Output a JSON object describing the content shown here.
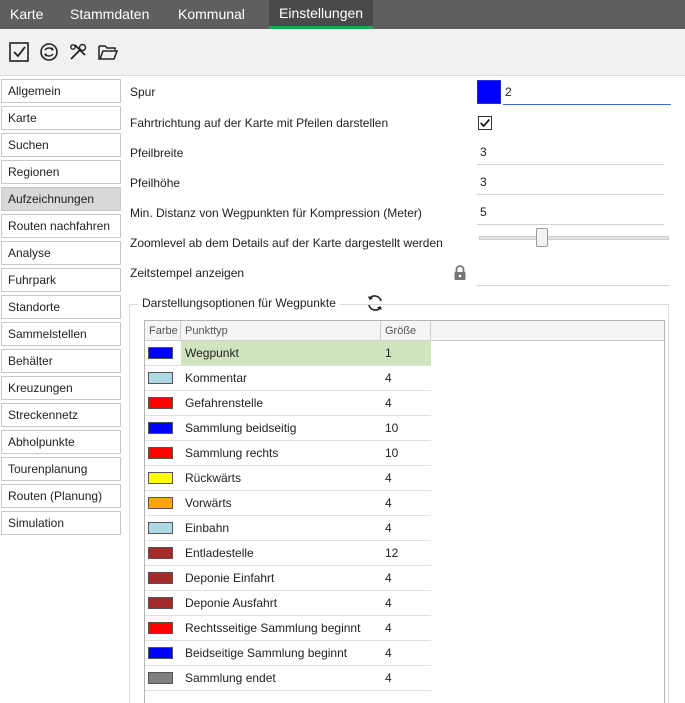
{
  "menu": {
    "tabs": [
      {
        "label": "Karte"
      },
      {
        "label": "Stammdaten"
      },
      {
        "label": "Kommunal"
      },
      {
        "label": "Einstellungen",
        "active": true
      }
    ]
  },
  "toolbar": {
    "icons": [
      "check-icon",
      "sync-icon",
      "tools-icon",
      "folder-open-icon"
    ]
  },
  "sidebar": {
    "items": [
      {
        "label": "Allgemein"
      },
      {
        "label": "Karte"
      },
      {
        "label": "Suchen"
      },
      {
        "label": "Regionen"
      },
      {
        "label": "Aufzeichnungen",
        "active": true
      },
      {
        "label": "Routen nachfahren"
      },
      {
        "label": "Analyse"
      },
      {
        "label": "Fuhrpark"
      },
      {
        "label": "Standorte"
      },
      {
        "label": "Sammelstellen"
      },
      {
        "label": "Behälter"
      },
      {
        "label": "Kreuzungen"
      },
      {
        "label": "Streckennetz"
      },
      {
        "label": "Abholpunkte"
      },
      {
        "label": "Tourenplanung"
      },
      {
        "label": "Routen (Planung)"
      },
      {
        "label": "Simulation"
      }
    ]
  },
  "settings": {
    "spur": {
      "label": "Spur",
      "value": "2",
      "color": "#0000ff"
    },
    "arrows": {
      "label": "Fahrtrichtung auf der Karte mit Pfeilen darstellen",
      "checked": true
    },
    "arrow_width": {
      "label": "Pfeilbreite",
      "value": "3"
    },
    "arrow_height": {
      "label": "Pfeilhöhe",
      "value": "3"
    },
    "min_distance": {
      "label": "Min. Distanz von Wegpunkten für Kompression (Meter)",
      "value": "5"
    },
    "zoomlevel": {
      "label": "Zoomlevel ab dem Details auf der Karte dargestellt werden",
      "slider_fraction": 0.3
    },
    "timestamp": {
      "label": "Zeitstempel anzeigen",
      "locked": true
    }
  },
  "waypoints": {
    "title": "Darstellungsoptionen für Wegpunkte",
    "columns": {
      "color": "Farbe",
      "type": "Punkttyp",
      "size": "Größe"
    },
    "rows": [
      {
        "color": "#0000ff",
        "type": "Wegpunkt",
        "size": "1",
        "selected": true
      },
      {
        "color": "#add8e6",
        "type": "Kommentar",
        "size": "4"
      },
      {
        "color": "#ff0000",
        "type": "Gefahrenstelle",
        "size": "4"
      },
      {
        "color": "#0000ff",
        "type": "Sammlung beidseitig",
        "size": "10"
      },
      {
        "color": "#ff0000",
        "type": "Sammlung rechts",
        "size": "10"
      },
      {
        "color": "#ffff00",
        "type": "Rückwärts",
        "size": "4"
      },
      {
        "color": "#ffa500",
        "type": "Vorwärts",
        "size": "4"
      },
      {
        "color": "#add8e6",
        "type": "Einbahn",
        "size": "4"
      },
      {
        "color": "#a52a2a",
        "type": "Entladestelle",
        "size": "12"
      },
      {
        "color": "#a52a2a",
        "type": "Deponie Einfahrt",
        "size": "4"
      },
      {
        "color": "#a52a2a",
        "type": "Deponie Ausfahrt",
        "size": "4"
      },
      {
        "color": "#ff0000",
        "type": "Rechtsseitige Sammlung beginnt",
        "size": "4"
      },
      {
        "color": "#0000ff",
        "type": "Beidseitige Sammlung beginnt",
        "size": "4"
      },
      {
        "color": "#808080",
        "type": "Sammlung endet",
        "size": "4"
      }
    ]
  }
}
